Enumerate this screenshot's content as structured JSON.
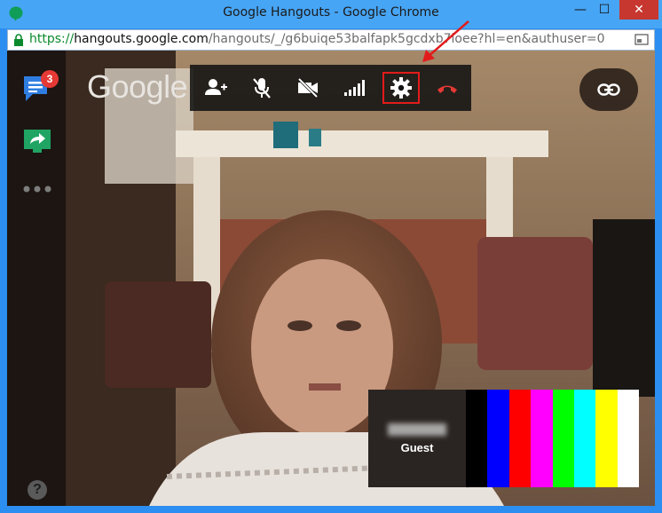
{
  "window": {
    "title": "Google Hangouts - Google Chrome",
    "min_glyph": "—",
    "max_glyph": "☐",
    "close_glyph": "✕"
  },
  "address_bar": {
    "scheme": "https://",
    "host": "hangouts.google.com",
    "path": "/hangouts/_/g6buiqe53balfapk5gcdxb7loee?hl=en&authuser=0"
  },
  "sidebar": {
    "chat_badge_count": "3",
    "help_glyph": "?"
  },
  "logo_text": "Google",
  "toolbar": {
    "buttons": [
      {
        "icon": "add-person-icon"
      },
      {
        "icon": "mic-muted-icon"
      },
      {
        "icon": "camera-off-icon"
      },
      {
        "icon": "signal-bars-icon"
      },
      {
        "icon": "settings-icon",
        "highlighted": true
      },
      {
        "icon": "hang-up-icon"
      }
    ]
  },
  "thumbnail": {
    "guest_label": "Guest",
    "color_bars": [
      "#000000",
      "#0000ff",
      "#ff0000",
      "#ff00ff",
      "#00ff00",
      "#00ffff",
      "#ffff00",
      "#ffffff"
    ]
  },
  "colors": {
    "window_frame": "#2b8ef0",
    "highlight_red": "#e21b1b",
    "hangup_red": "#e53935",
    "badge_red": "#e53935",
    "secure_green": "#0a8a2c"
  }
}
